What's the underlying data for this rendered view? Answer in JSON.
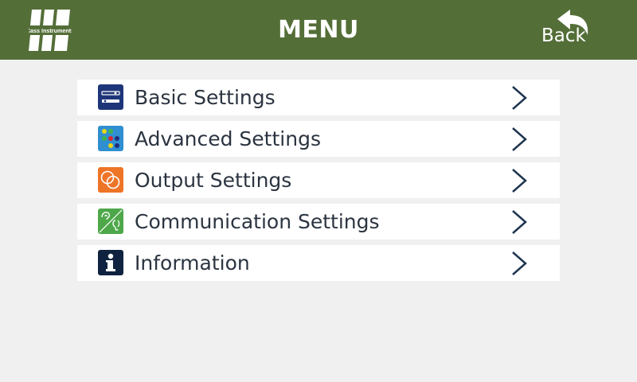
{
  "header": {
    "logo_text": "Cass Instruments",
    "title": "MENU",
    "back_label": "Back"
  },
  "menu": {
    "items": [
      {
        "label": "Basic Settings",
        "icon": "basic-settings-icon"
      },
      {
        "label": "Advanced Settings",
        "icon": "advanced-settings-icon"
      },
      {
        "label": "Output Settings",
        "icon": "output-settings-icon"
      },
      {
        "label": "Communication Settings",
        "icon": "communication-settings-icon"
      },
      {
        "label": "Information",
        "icon": "info-icon"
      }
    ]
  },
  "colors": {
    "header_bg": "#546e38",
    "page_bg": "#f0f0f0",
    "row_bg": "#ffffff",
    "text": "#2b3440",
    "chevron": "#1f3550"
  }
}
